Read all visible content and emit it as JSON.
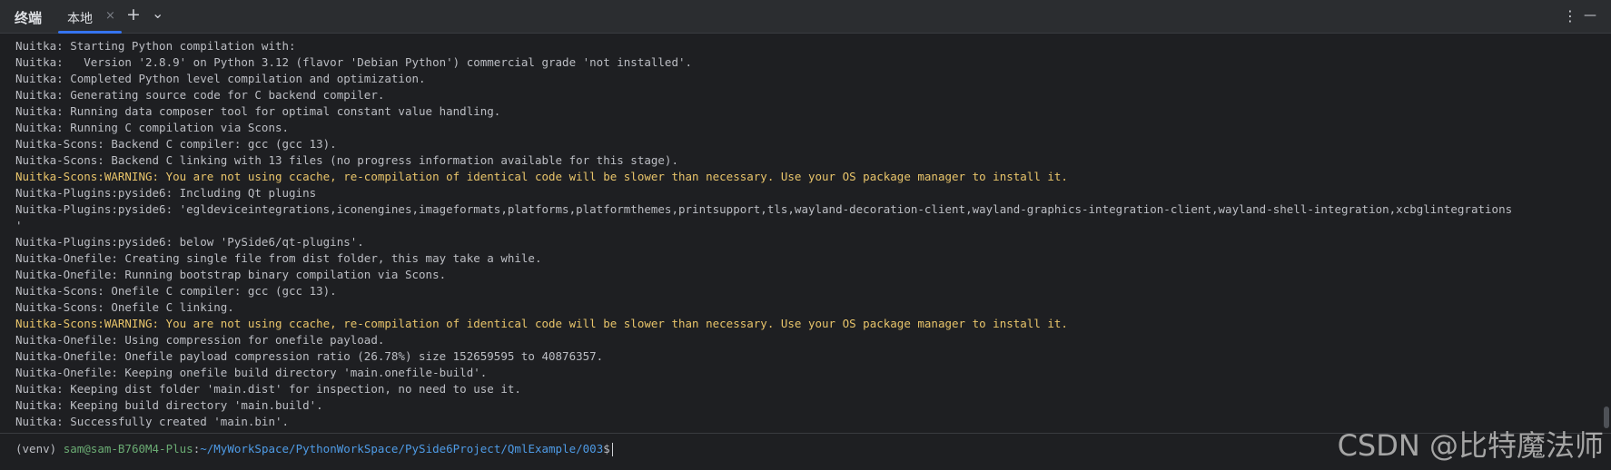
{
  "header": {
    "panel_title": "终端",
    "tab_label": "本地",
    "tab_close_glyph": "×",
    "add_glyph": "+",
    "dropdown_glyph": "⌄",
    "more_glyph": "⋮",
    "minimize_glyph": "—"
  },
  "colors": {
    "background": "#1e1f22",
    "text": "#bcbec4",
    "warning": "#e8c46a",
    "prompt_user": "#6aab73",
    "prompt_path": "#4e9be6",
    "tab_accent": "#3574f0"
  },
  "terminal": {
    "lines": [
      {
        "text": "Nuitka: Starting Python compilation with:",
        "type": "normal"
      },
      {
        "text": "Nuitka:   Version '2.8.9' on Python 3.12 (flavor 'Debian Python') commercial grade 'not installed'.",
        "type": "normal"
      },
      {
        "text": "Nuitka: Completed Python level compilation and optimization.",
        "type": "normal"
      },
      {
        "text": "Nuitka: Generating source code for C backend compiler.",
        "type": "normal"
      },
      {
        "text": "Nuitka: Running data composer tool for optimal constant value handling.",
        "type": "normal"
      },
      {
        "text": "Nuitka: Running C compilation via Scons.",
        "type": "normal"
      },
      {
        "text": "Nuitka-Scons: Backend C compiler: gcc (gcc 13).",
        "type": "normal"
      },
      {
        "text": "Nuitka-Scons: Backend C linking with 13 files (no progress information available for this stage).",
        "type": "normal"
      },
      {
        "text": "Nuitka-Scons:WARNING: You are not using ccache, re-compilation of identical code will be slower than necessary. Use your OS package manager to install it.",
        "type": "warn"
      },
      {
        "text": "Nuitka-Plugins:pyside6: Including Qt plugins",
        "type": "normal"
      },
      {
        "text": "Nuitka-Plugins:pyside6: 'egldeviceintegrations,iconengines,imageformats,platforms,platformthemes,printsupport,tls,wayland-decoration-client,wayland-graphics-integration-client,wayland-shell-integration,xcbglintegrations",
        "type": "normal"
      },
      {
        "text": "'",
        "type": "normal"
      },
      {
        "text": "Nuitka-Plugins:pyside6: below 'PySide6/qt-plugins'.",
        "type": "normal"
      },
      {
        "text": "Nuitka-Onefile: Creating single file from dist folder, this may take a while.",
        "type": "normal"
      },
      {
        "text": "Nuitka-Onefile: Running bootstrap binary compilation via Scons.",
        "type": "normal"
      },
      {
        "text": "Nuitka-Scons: Onefile C compiler: gcc (gcc 13).",
        "type": "normal"
      },
      {
        "text": "Nuitka-Scons: Onefile C linking.",
        "type": "normal"
      },
      {
        "text": "Nuitka-Scons:WARNING: You are not using ccache, re-compilation of identical code will be slower than necessary. Use your OS package manager to install it.",
        "type": "warn"
      },
      {
        "text": "Nuitka-Onefile: Using compression for onefile payload.",
        "type": "normal"
      },
      {
        "text": "Nuitka-Onefile: Onefile payload compression ratio (26.78%) size 152659595 to 40876357.",
        "type": "normal"
      },
      {
        "text": "Nuitka-Onefile: Keeping onefile build directory 'main.onefile-build'.",
        "type": "normal"
      },
      {
        "text": "Nuitka: Keeping dist folder 'main.dist' for inspection, no need to use it.",
        "type": "normal"
      },
      {
        "text": "Nuitka: Keeping build directory 'main.build'.",
        "type": "normal"
      },
      {
        "text": "Nuitka: Successfully created 'main.bin'.",
        "type": "normal"
      }
    ]
  },
  "prompt": {
    "venv": "(venv) ",
    "user_host": "sam@sam-B760M4-Plus",
    "separator": ":",
    "path": "~/MyWorkSpace/PythonWorkSpace/PySide6Project/QmlExample/003",
    "dollar": "$"
  },
  "watermark": "CSDN @比特魔法师"
}
